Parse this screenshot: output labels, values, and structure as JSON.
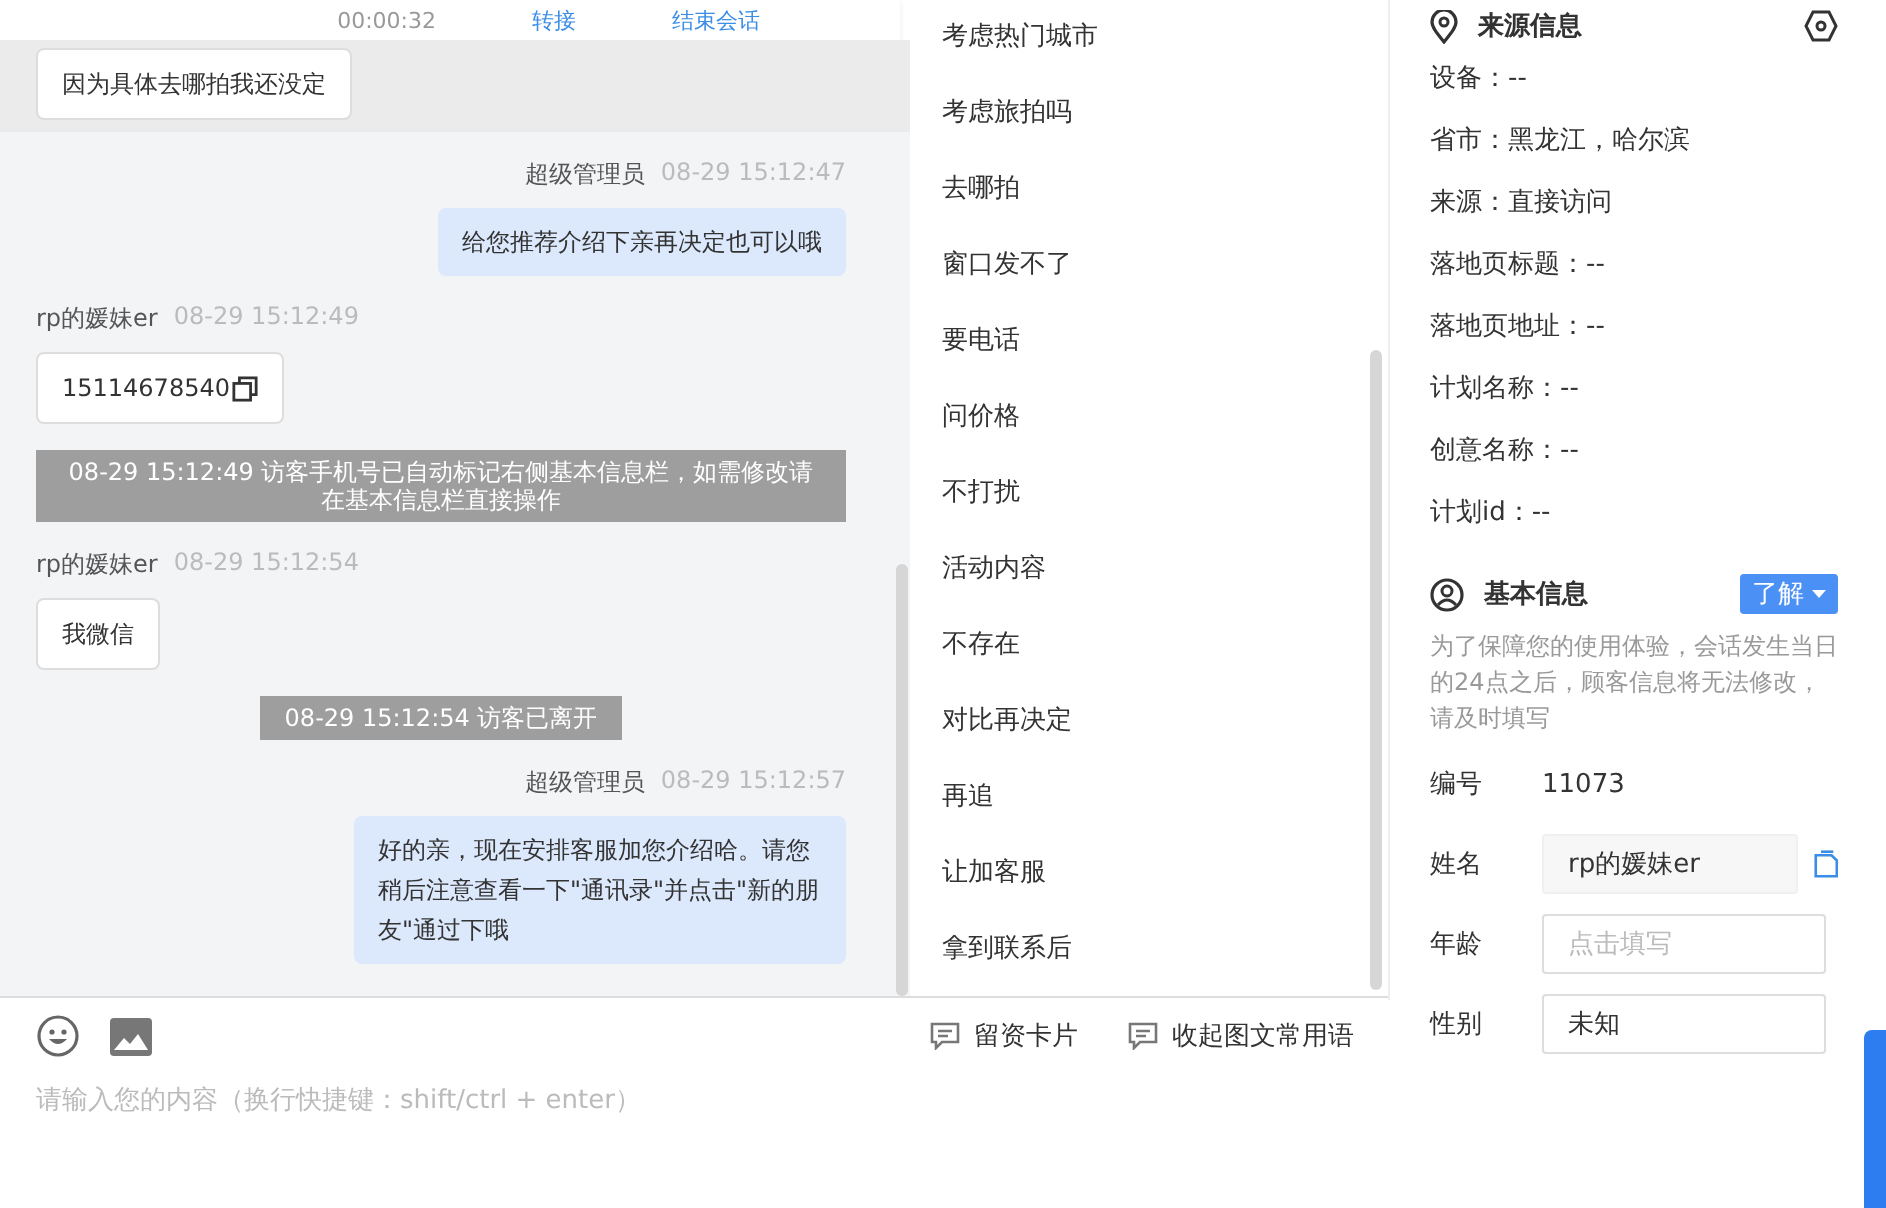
{
  "header": {
    "timer": "00:00:32",
    "actions": [
      "转接",
      "结束会话"
    ]
  },
  "messages": [
    {
      "kind": "visitor",
      "highlighted": true,
      "text": "因为具体去哪拍我还没定"
    },
    {
      "kind": "agent",
      "sender": "超级管理员",
      "time": "08-29 15:12:47",
      "text": "给您推荐介绍下亲再决定也可以哦"
    },
    {
      "kind": "visitor",
      "sender": "rp的媛妹er",
      "time": "08-29 15:12:49",
      "text": "15114678540",
      "copyable": true
    },
    {
      "kind": "system",
      "text": "08-29 15:12:49 访客手机号已自动标记右侧基本信息栏，如需修改请在基本信息栏直接操作"
    },
    {
      "kind": "visitor",
      "sender": "rp的媛妹er",
      "time": "08-29 15:12:54",
      "text": "我微信"
    },
    {
      "kind": "system",
      "text": "08-29 15:12:54 访客已离开"
    },
    {
      "kind": "agent",
      "sender": "超级管理员",
      "time": "08-29 15:12:57",
      "text": "好的亲，现在安排客服加您介绍哈。请您稍后注意查看一下\"通讯录\"并点击\"新的朋友\"通过下哦"
    }
  ],
  "toolbar": {
    "actions": [
      "留资卡片",
      "收起图文常用语"
    ]
  },
  "input": {
    "placeholder": "请输入您的内容（换行快捷键：shift/ctrl + enter）"
  },
  "quick_replies": [
    "考虑热门城市",
    "考虑旅拍吗",
    "去哪拍",
    "窗口发不了",
    "要电话",
    "问价格",
    "不打扰",
    "活动内容",
    "不存在",
    "对比再决定",
    "再追",
    "让加客服",
    "拿到联系后"
  ],
  "source_info": {
    "title": "来源信息",
    "rows": [
      "设备：--",
      "省市：黑龙江，哈尔滨",
      "来源：直接访问",
      "落地页标题：--",
      "落地页地址：--",
      "计划名称：--",
      "创意名称：--",
      "计划id：--"
    ]
  },
  "basic_info": {
    "title": "基本信息",
    "dropdown": "了解",
    "notice": "为了保障您的使用体验，会话发生当日的24点之后，顾客信息将无法修改，请及时填写",
    "id_label": "编号",
    "id_value": "11073",
    "fields": [
      {
        "label": "姓名",
        "value": "rp的媛妹er",
        "readonly": true
      },
      {
        "label": "年龄",
        "placeholder": "点击填写",
        "readonly": false
      },
      {
        "label": "性别",
        "value": "未知",
        "readonly": false
      }
    ]
  }
}
